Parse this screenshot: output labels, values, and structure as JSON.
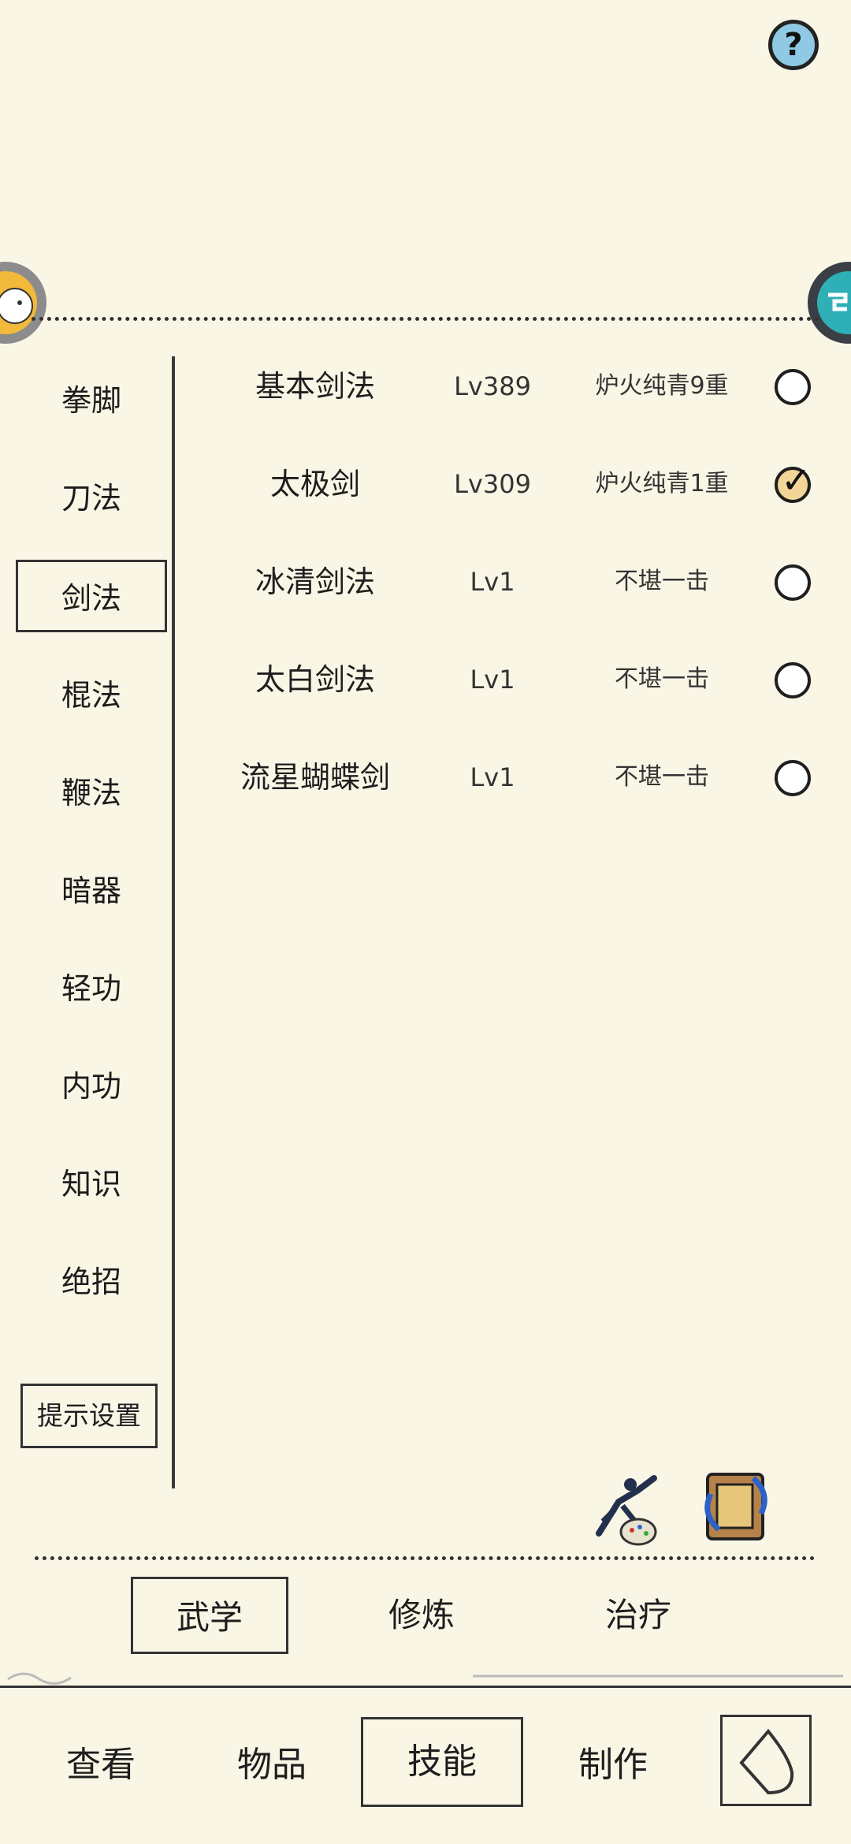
{
  "header": {
    "help_label": "?"
  },
  "categories": [
    {
      "label": "拳脚"
    },
    {
      "label": "刀法"
    },
    {
      "label": "剑法",
      "selected": true
    },
    {
      "label": "棍法"
    },
    {
      "label": "鞭法"
    },
    {
      "label": "暗器"
    },
    {
      "label": "轻功"
    },
    {
      "label": "内功"
    },
    {
      "label": "知识"
    },
    {
      "label": "绝招"
    }
  ],
  "hint_settings_label": "提示设置",
  "skills": [
    {
      "name": "基本剑法",
      "level": "Lv389",
      "rank": "炉火纯青9重",
      "checked": false
    },
    {
      "name": "太极剑",
      "level": "Lv309",
      "rank": "炉火纯青1重",
      "checked": true
    },
    {
      "name": "冰清剑法",
      "level": "Lv1",
      "rank": "不堪一击",
      "checked": false
    },
    {
      "name": "太白剑法",
      "level": "Lv1",
      "rank": "不堪一击",
      "checked": false
    },
    {
      "name": "流星蝴蝶剑",
      "level": "Lv1",
      "rank": "不堪一击",
      "checked": false
    }
  ],
  "sub_tabs": [
    {
      "label": "武学",
      "selected": true
    },
    {
      "label": "修炼"
    },
    {
      "label": "治疗"
    }
  ],
  "bottom_nav": [
    {
      "label": "查看"
    },
    {
      "label": "物品"
    },
    {
      "label": "技能",
      "selected": true
    },
    {
      "label": "制作"
    }
  ],
  "icons": {
    "help": "question-icon",
    "tick": "checkmark-icon",
    "back": "back-arrow-icon"
  },
  "colors": {
    "background": "#faf6e6",
    "check_on": "#f4d598",
    "help_button": "#8fc9e3"
  }
}
